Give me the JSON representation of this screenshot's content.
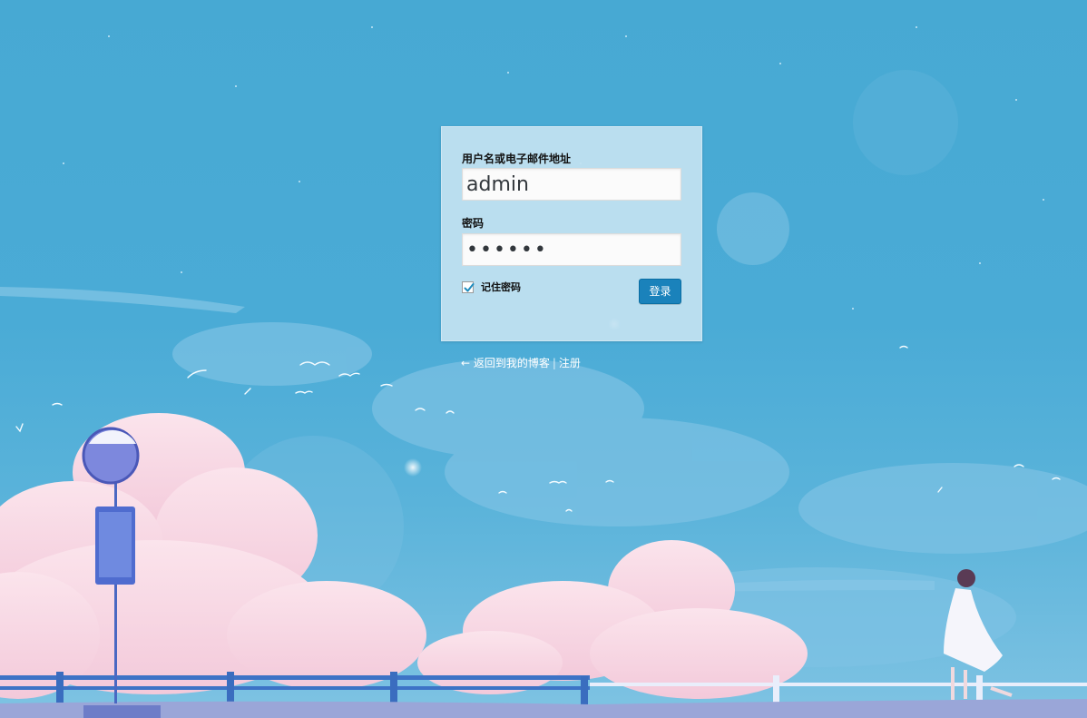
{
  "login_form": {
    "username_label": "用户名或电子邮件地址",
    "username_value": "admin",
    "password_label": "密码",
    "password_value": "••••••",
    "remember_label": "记住密码",
    "remember_checked": true,
    "submit_label": "登录"
  },
  "nav": {
    "back_link": "← 返回到我的博客",
    "separator": "|",
    "register_link": "注册"
  },
  "colors": {
    "sky": "#4aabd6",
    "button": "#1a82bb",
    "box": "#c3e2f1"
  }
}
